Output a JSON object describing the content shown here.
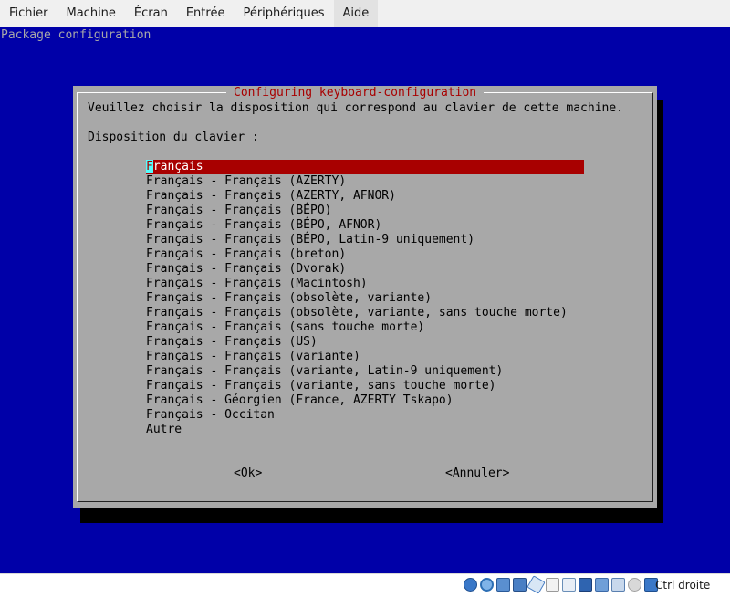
{
  "menubar": {
    "items": [
      {
        "label": "Fichier"
      },
      {
        "label": "Machine"
      },
      {
        "label": "Écran"
      },
      {
        "label": "Entrée"
      },
      {
        "label": "Périphériques"
      },
      {
        "label": "Aide"
      }
    ]
  },
  "screen": {
    "title": "Package configuration",
    "dialog": {
      "title": "Configuring keyboard-configuration",
      "prompt": "Veuillez choisir la disposition qui correspond au clavier de cette machine.",
      "list_label": "Disposition du clavier :",
      "selected_first_char": "F",
      "selected_rest": "rançais",
      "options": [
        "Français - Français (AZERTY)",
        "Français - Français (AZERTY, AFNOR)",
        "Français - Français (BÉPO)",
        "Français - Français (BÉPO, AFNOR)",
        "Français - Français (BÉPO, Latin-9 uniquement)",
        "Français - Français (breton)",
        "Français - Français (Dvorak)",
        "Français - Français (Macintosh)",
        "Français - Français (obsolète, variante)",
        "Français - Français (obsolète, variante, sans touche morte)",
        "Français - Français (sans touche morte)",
        "Français - Français (US)",
        "Français - Français (variante)",
        "Français - Français (variante, Latin-9 uniquement)",
        "Français - Français (variante, sans touche morte)",
        "Français - Géorgien (France, AZERTY Tskapo)",
        "Français - Occitan",
        "Autre"
      ],
      "ok_label": "<Ok>",
      "cancel_label": "<Annuler>"
    }
  },
  "statusbar": {
    "host_key": "Ctrl droite",
    "icons": [
      "hard-disk-icon",
      "optical-drive-icon",
      "audio-icon",
      "network-icon",
      "usb-icon",
      "shared-folders-icon",
      "display-icon",
      "screen-capture-icon",
      "recording-icon",
      "virtualization-icon",
      "mouse-integration-icon",
      "keyboard-capture-icon"
    ]
  },
  "colors": {
    "screen_bg": "#0000a8",
    "dialog_bg": "#a8a8a8",
    "title_fg": "#a80000",
    "selection_bg": "#a80000",
    "cursor_bg": "#54fcfc"
  }
}
